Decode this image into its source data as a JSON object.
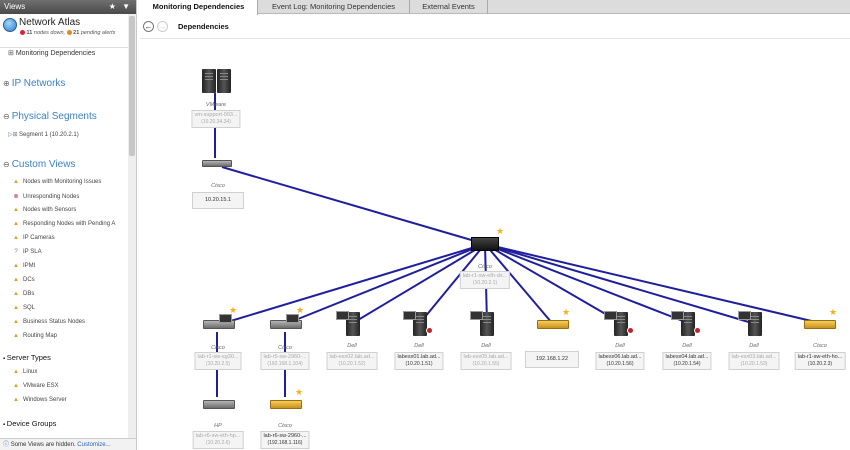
{
  "sidebar": {
    "header": "Views",
    "tools": "★ ▼",
    "atlas_title": "Network Atlas",
    "nodes_down_count": "11",
    "nodes_down_label": "nodes down,",
    "pending_count": "21",
    "pending_label": "pending alerts",
    "monitoring_dependencies": "Monitoring Dependencies",
    "ip_networks": "IP Networks",
    "physical_segments": "Physical Segments",
    "segment1": "Segment 1 (10.20.2.1)",
    "custom_views": "Custom Views",
    "custom_items": [
      "Nodes with Monitoring Issues",
      "Unresponding Nodes",
      "Nodes with Sensors",
      "Responding Nodes with Pending A",
      "IP Cameras",
      "IP SLA",
      "IPMI",
      "DCs",
      "DBs",
      "SQL",
      "Business Status Nodes",
      "Routing Map"
    ],
    "server_types": "Server Types",
    "server_items": [
      "Linux",
      "VMware ESX",
      "Windows Server"
    ],
    "device_groups": "Device Groups",
    "footer_text": "Some Views are hidden.",
    "footer_link": "Customize..."
  },
  "tabs": [
    "Monitoring Dependencies",
    "Event Log: Monitoring Dependencies",
    "External Events"
  ],
  "toolbar": {
    "back": "←",
    "forward": "→",
    "title": "Dependencies"
  },
  "nodes": {
    "vmware_vendor": "VMware",
    "vmware_name": "vm-support-003...",
    "vmware_ip": "(10.20.34.34)",
    "cisco_top_vendor": "Cisco",
    "cisco_top_ip": "10.20.15.1",
    "core_vendor": "Cisco",
    "core_name": "lab-r1-sw-eth-ds...",
    "core_ip": "(10.20.2.1)",
    "n1_vendor": "Cisco",
    "n1_name": "lab-r1-sw-sg30...",
    "n1_ip": "(10.20.2.5)",
    "n2_vendor": "Cisco",
    "n2_name": "lab-r5-sw-2960-...",
    "n2_ip": "(192.168.1.104)",
    "n3_vendor": "Dell",
    "n3_name": "lab-esx02.lab.ad...",
    "n3_ip": "(10.20.1.52)",
    "n4_vendor": "Dell",
    "n4_name": "labesx01.lab.ad...",
    "n4_ip": "(10.20.1.51)",
    "n5_vendor": "Dell",
    "n5_name": "lab-esx05.lab.ad...",
    "n5_ip": "(10.20.1.55)",
    "n6_ip": "192.168.1.22",
    "n7_vendor": "Dell",
    "n7_name": "labesx06.lab.ad...",
    "n7_ip": "(10.20.1.56)",
    "n8_vendor": "Dell",
    "n8_name": "labesx04.lab.ad...",
    "n8_ip": "(10.20.1.54)",
    "n9_vendor": "Dell",
    "n9_name": "lab-esx03.lab.ad...",
    "n9_ip": "(10.20.1.53)",
    "n10_vendor": "Cisco",
    "n10_name": "lab-r1-sw-eth-ho...",
    "n10_ip": "(10.20.2.3)",
    "n11_vendor": "HP",
    "n11_name": "lab-r6-sw-eth-hp...",
    "n11_ip": "(10.20.2.6)",
    "n12_vendor": "Cisco",
    "n12_name": "lab-r6-sw-2960-...",
    "n12_ip": "(192.168.1.116)"
  },
  "colors": {
    "link": "#1f1f9e",
    "accent": "#3a82c4",
    "star": "#f2b01c",
    "alert": "#c8202a"
  }
}
